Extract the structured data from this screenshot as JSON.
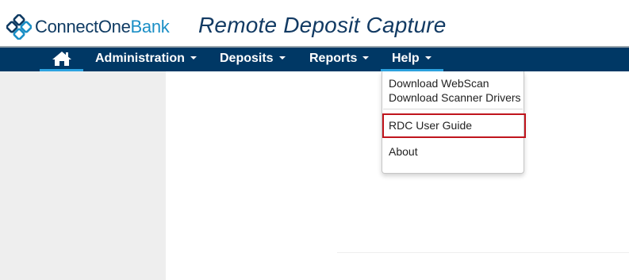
{
  "header": {
    "logo": {
      "part1": "ConnectOne",
      "part2": "Bank"
    },
    "app_title": "Remote Deposit Capture"
  },
  "nav": {
    "home_icon": "home-icon",
    "items": [
      {
        "label": "Administration"
      },
      {
        "label": "Deposits"
      },
      {
        "label": "Reports"
      },
      {
        "label": "Help"
      }
    ]
  },
  "help_menu": {
    "items": [
      {
        "label": "Download WebScan"
      },
      {
        "label": "Download Scanner Drivers"
      },
      {
        "label": "RDC User Guide"
      },
      {
        "label": "About"
      }
    ],
    "highlight_color": "#c0151d"
  },
  "colors": {
    "navbar": "#003865",
    "brand_dark": "#0f3b63",
    "brand_light": "#1b8fc6",
    "active_underline": "#2da3e0"
  }
}
